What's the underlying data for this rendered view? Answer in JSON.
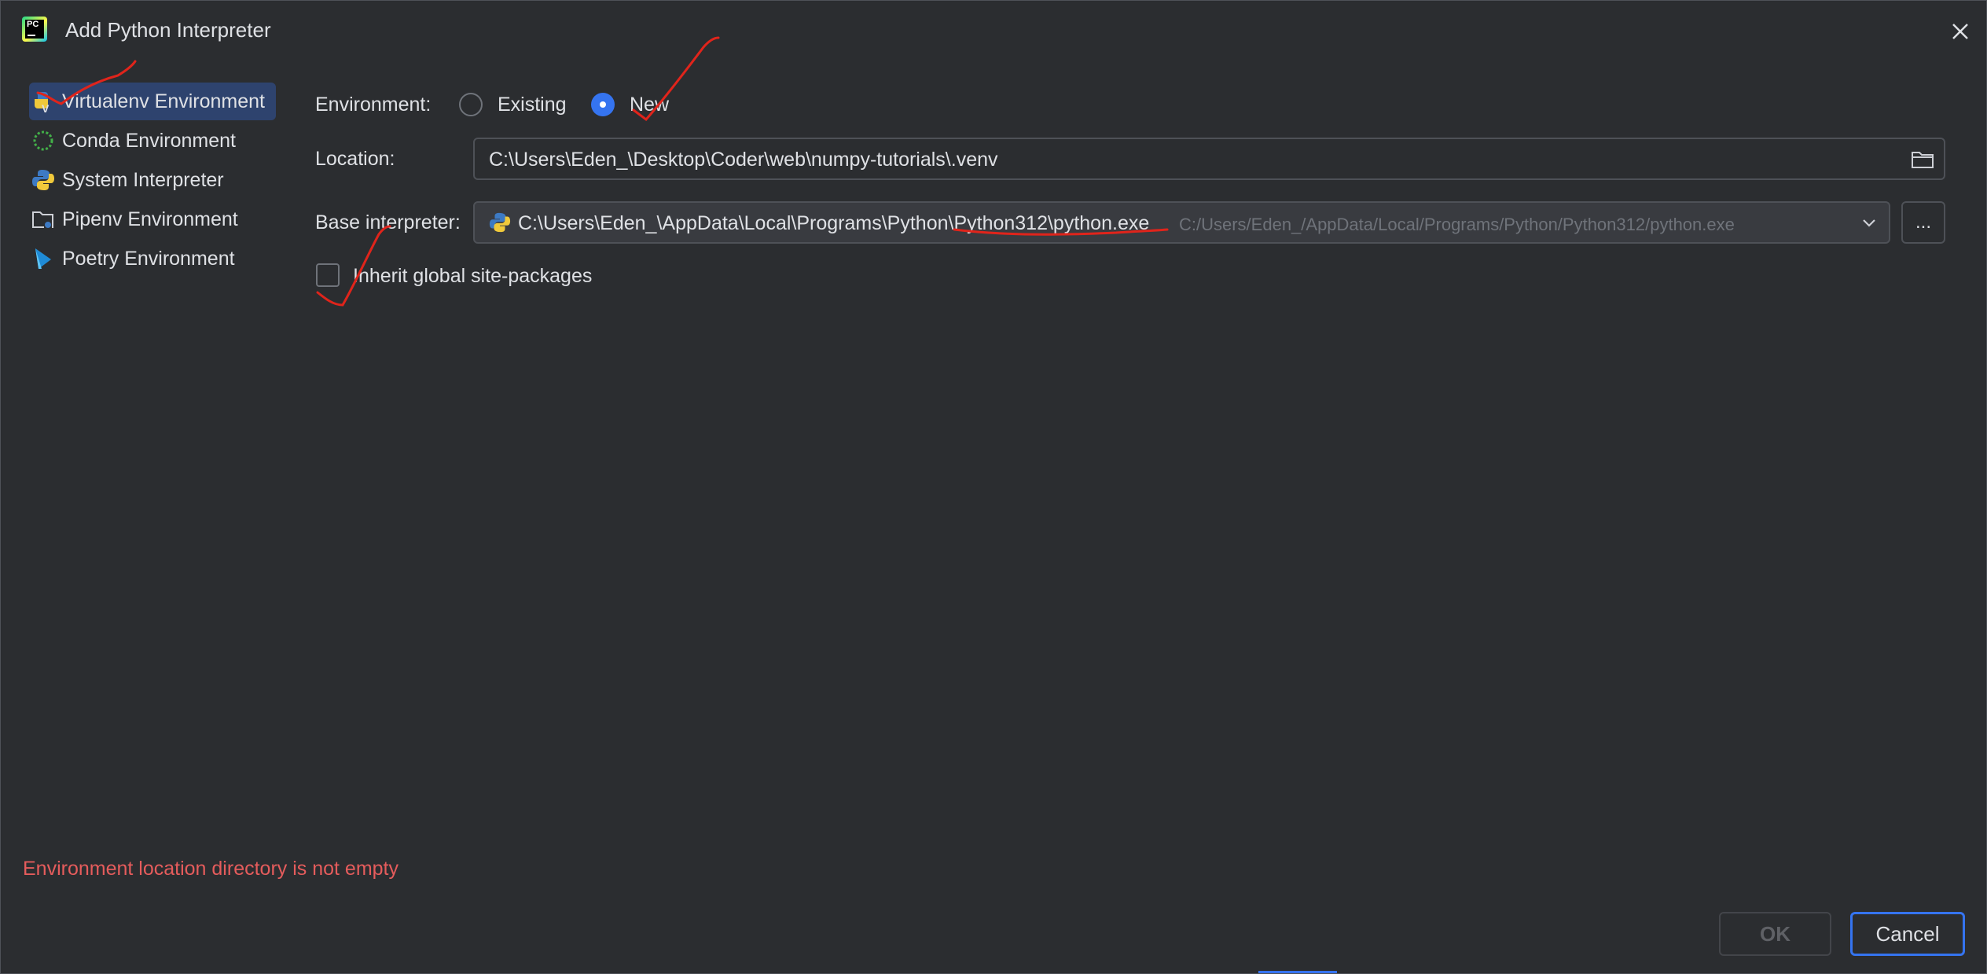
{
  "window": {
    "title": "Add Python Interpreter"
  },
  "sidebar": {
    "items": [
      {
        "label": "Virtualenv Environment",
        "icon": "virtualenv-icon",
        "selected": true
      },
      {
        "label": "Conda Environment",
        "icon": "conda-icon",
        "selected": false
      },
      {
        "label": "System Interpreter",
        "icon": "python-icon",
        "selected": false
      },
      {
        "label": "Pipenv Environment",
        "icon": "pipenv-folder-icon",
        "selected": false
      },
      {
        "label": "Poetry Environment",
        "icon": "poetry-icon",
        "selected": false
      }
    ]
  },
  "form": {
    "environment_label": "Environment:",
    "option_existing": "Existing",
    "option_new": "New",
    "selected_option": "New",
    "location_label": "Location:",
    "location_value": "C:\\Users\\Eden_\\Desktop\\Coder\\web\\numpy-tutorials\\.venv",
    "base_label": "Base interpreter:",
    "base_value": "C:\\Users\\Eden_\\AppData\\Local\\Programs\\Python\\Python312\\python.exe",
    "base_hint": "C:/Users/Eden_/AppData/Local/Programs/Python/Python312/python.exe",
    "browse_label": "...",
    "inherit_label": "Inherit global site-packages",
    "inherit_checked": false
  },
  "error": {
    "message": "Environment location directory is not empty"
  },
  "buttons": {
    "ok": "OK",
    "cancel": "Cancel"
  },
  "colors": {
    "background": "#2b2d30",
    "accent": "#3574f0",
    "selection": "#2e436e",
    "error": "#e55c5c",
    "annotation": "#e0241b"
  }
}
